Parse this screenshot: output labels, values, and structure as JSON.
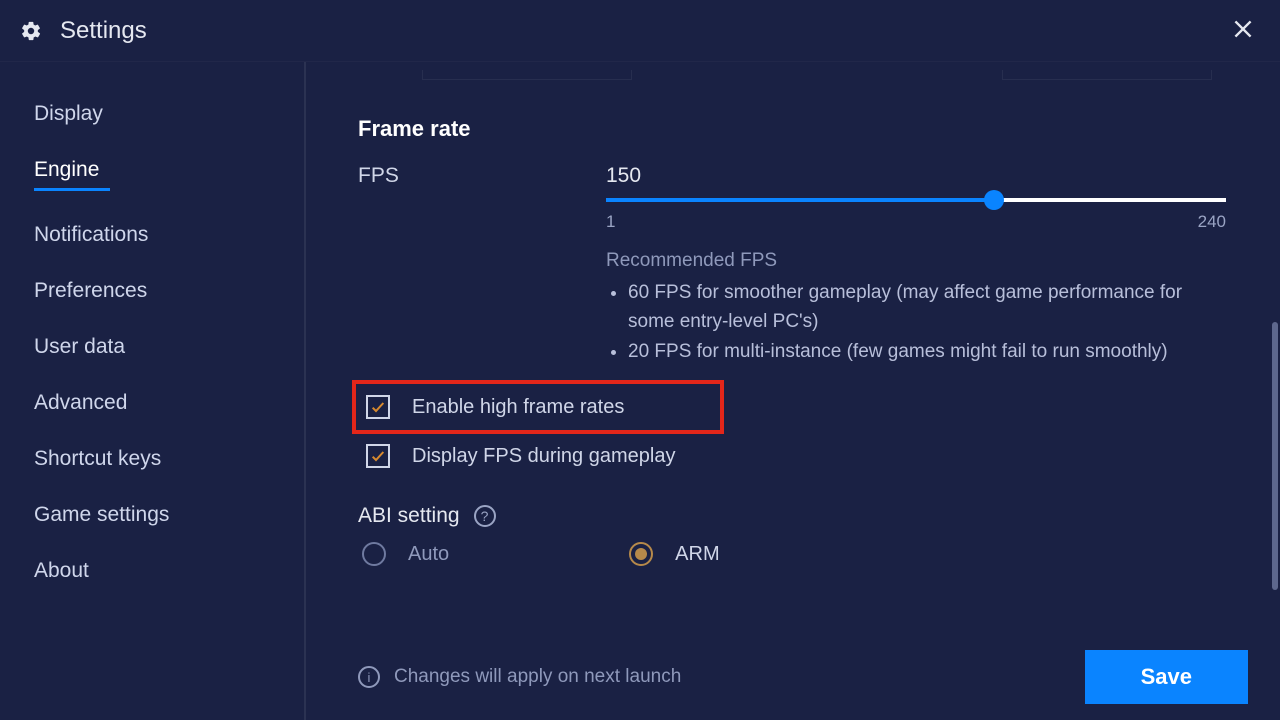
{
  "header": {
    "title": "Settings"
  },
  "sidebar": {
    "items": [
      {
        "label": "Display"
      },
      {
        "label": "Engine",
        "active": true
      },
      {
        "label": "Notifications"
      },
      {
        "label": "Preferences"
      },
      {
        "label": "User data"
      },
      {
        "label": "Advanced"
      },
      {
        "label": "Shortcut keys"
      },
      {
        "label": "Game settings"
      },
      {
        "label": "About"
      }
    ]
  },
  "frame": {
    "section_title": "Frame rate",
    "fps_label": "FPS",
    "fps_value": "150",
    "slider": {
      "min": "1",
      "max": "240",
      "value": 150
    },
    "rec_title": "Recommended FPS",
    "rec_items": [
      "60 FPS for smoother gameplay (may affect game performance for some entry-level PC's)",
      "20 FPS for multi-instance (few games might fail to run smoothly)"
    ],
    "checkboxes": {
      "high_fps": {
        "label": "Enable high frame rates",
        "checked": true
      },
      "display_fps": {
        "label": "Display FPS during gameplay",
        "checked": true
      }
    }
  },
  "abi": {
    "title": "ABI setting",
    "options": [
      {
        "label": "Auto",
        "selected": false
      },
      {
        "label": "ARM",
        "selected": true
      }
    ]
  },
  "footer": {
    "info": "Changes will apply on next launch",
    "save": "Save"
  }
}
